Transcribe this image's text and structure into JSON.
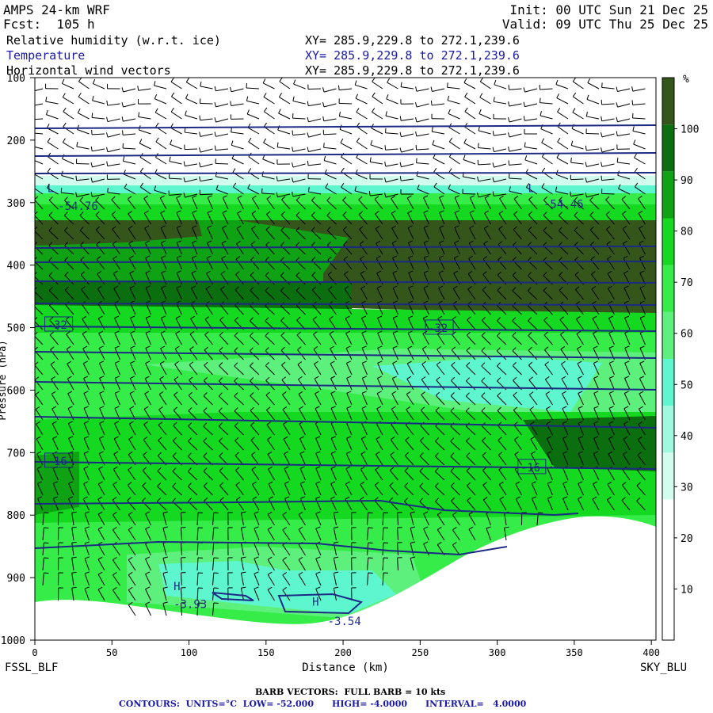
{
  "header": {
    "model": "AMPS 24-km WRF",
    "forecast": "Fcst:  105 h",
    "init": "Init: 00 UTC Sun 21 Dec 25",
    "valid": "Valid: 09 UTC Thu 25 Dec 25",
    "fields": [
      {
        "name": "Relative humidity (w.r.t. ice)",
        "xy": "XY= 285.9,229.8 to 272.1,239.6"
      },
      {
        "name": "Temperature",
        "xy": "XY= 285.9,229.8 to 272.1,239.6"
      },
      {
        "name": "Horizontal wind vectors",
        "xy": "XY= 285.9,229.8 to 272.1,239.6"
      }
    ]
  },
  "footer": {
    "barb": "BARB VECTORS:  FULL BARB = 10 kts",
    "contours": "CONTOURS:  UNITS=°C  LOW= -52.000      HIGH= -4.0000      INTERVAL=   4.0000"
  },
  "colors": {
    "contour": "#1c2a84",
    "colorbar": [
      "#ffffff",
      "#ffffff",
      "#ffffff",
      "#d2fcee",
      "#9ef9de",
      "#5ef6cf",
      "#5df07d",
      "#36ec49",
      "#15d821",
      "#0fa214",
      "#0b6f0f",
      "#35561b"
    ]
  },
  "chart_data": {
    "type": "heatmap",
    "xlabel": "Distance (km)",
    "ylabel": "Pressure (hPa)",
    "xlim": [
      0,
      403
    ],
    "ylim": [
      1000,
      100
    ],
    "x_ticks": [
      0,
      50,
      100,
      150,
      200,
      250,
      300,
      350,
      400
    ],
    "y_ticks": [
      100,
      200,
      300,
      400,
      500,
      600,
      700,
      800,
      900,
      1000
    ],
    "left_endpoint": "FSSL_BLF",
    "right_endpoint": "SKY_BLU",
    "colorbar": {
      "unit": "%",
      "ticks": [
        10,
        20,
        30,
        40,
        50,
        60,
        70,
        80,
        90,
        100
      ],
      "bounds": [
        0,
        110
      ]
    },
    "temperature_labels": [
      {
        "text": "-54.76",
        "x": 15,
        "p": 308
      },
      {
        "text": "-54.46",
        "x": 330,
        "p": 305
      },
      {
        "text": "-32",
        "x": 8,
        "p": 498
      },
      {
        "text": "-32",
        "x": 255,
        "p": 503
      },
      {
        "text": "-16",
        "x": 8,
        "p": 716
      },
      {
        "text": "-16",
        "x": 315,
        "p": 726
      },
      {
        "text": "-3.93",
        "x": 90,
        "p": 945
      },
      {
        "text": "-3.54",
        "x": 190,
        "p": 972
      }
    ],
    "extremum_labels": [
      {
        "text": "L",
        "x": 8,
        "p": 283
      },
      {
        "text": "L",
        "x": 320,
        "p": 283
      },
      {
        "text": "H",
        "x": 90,
        "p": 920
      },
      {
        "text": "H",
        "x": 180,
        "p": 945
      }
    ]
  }
}
